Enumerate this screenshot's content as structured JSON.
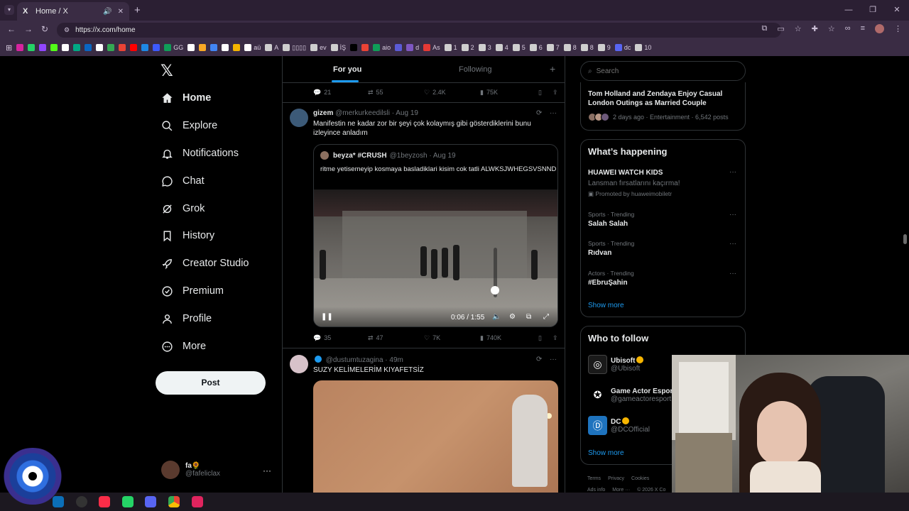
{
  "browser": {
    "tab_title": "Home / X",
    "url": "https://x.com/home",
    "new_tab_glyph": "+",
    "tab_close_glyph": "✕",
    "tab_audio_glyph": "🔊",
    "window_controls": [
      "—",
      "❐",
      "✕"
    ]
  },
  "bookmarks": [
    {
      "label": "",
      "color": "#d6249f"
    },
    {
      "label": "",
      "color": "#25d366"
    },
    {
      "label": "",
      "color": "#9146ff"
    },
    {
      "label": "",
      "color": "#53fc18"
    },
    {
      "label": "",
      "color": "#ffffff"
    },
    {
      "label": "",
      "color": "#00a884"
    },
    {
      "label": "",
      "color": "#0a66c2"
    },
    {
      "label": "",
      "color": "#ffffff"
    },
    {
      "label": "",
      "color": "#34a853"
    },
    {
      "label": "",
      "color": "#ea4335"
    },
    {
      "label": "",
      "color": "#ff0000"
    },
    {
      "label": "",
      "color": "#1e88e5"
    },
    {
      "label": "",
      "color": "#3d5afe"
    },
    {
      "label": "GG",
      "color": "#0f9d58"
    },
    {
      "label": "",
      "color": "#ffffff"
    },
    {
      "label": "",
      "color": "#f9a825"
    },
    {
      "label": "",
      "color": "#4285f4"
    },
    {
      "label": "",
      "color": "#ffffff"
    },
    {
      "label": "",
      "color": "#f4b400"
    },
    {
      "label": "aü",
      "color": "#ffffff"
    },
    {
      "label": "A",
      "color": "#cfcfcf"
    },
    {
      "label": "▯▯▯▯",
      "color": "#cfcfcf"
    },
    {
      "label": "ev",
      "color": "#cfcfcf"
    },
    {
      "label": "İŞ",
      "color": "#cfcfcf"
    },
    {
      "label": "",
      "color": "#000000"
    },
    {
      "label": "",
      "color": "#ea4335"
    },
    {
      "label": "aio",
      "color": "#0f9d58"
    },
    {
      "label": "",
      "color": "#5b5bd6"
    },
    {
      "label": "d",
      "color": "#7e57c2"
    },
    {
      "label": "As",
      "color": "#e53935"
    },
    {
      "label": "1",
      "color": "#cfcfcf"
    },
    {
      "label": "2",
      "color": "#cfcfcf"
    },
    {
      "label": "3",
      "color": "#cfcfcf"
    },
    {
      "label": "4",
      "color": "#cfcfcf"
    },
    {
      "label": "5",
      "color": "#cfcfcf"
    },
    {
      "label": "6",
      "color": "#cfcfcf"
    },
    {
      "label": "7",
      "color": "#cfcfcf"
    },
    {
      "label": "8",
      "color": "#cfcfcf"
    },
    {
      "label": "8",
      "color": "#cfcfcf"
    },
    {
      "label": "9",
      "color": "#cfcfcf"
    },
    {
      "label": "dc",
      "color": "#5865f2"
    },
    {
      "label": "10",
      "color": "#cfcfcf"
    }
  ],
  "sidebar": {
    "logo": "𝕏",
    "items": [
      {
        "label": "Home",
        "icon": "home-icon"
      },
      {
        "label": "Explore",
        "icon": "search-icon"
      },
      {
        "label": "Notifications",
        "icon": "bell-icon"
      },
      {
        "label": "Chat",
        "icon": "chat-icon"
      },
      {
        "label": "Grok",
        "icon": "grok-icon"
      },
      {
        "label": "History",
        "icon": "bookmark-icon"
      },
      {
        "label": "Creator Studio",
        "icon": "rocket-icon"
      },
      {
        "label": "Premium",
        "icon": "verified-icon"
      },
      {
        "label": "Profile",
        "icon": "person-icon"
      },
      {
        "label": "More",
        "icon": "more-circle-icon"
      }
    ],
    "post_label": "Post",
    "account": {
      "name": "fa🌻",
      "handle": "@fafeliclax",
      "more": "···"
    }
  },
  "feed": {
    "tabs": [
      "For you",
      "Following"
    ],
    "add_glyph": "+",
    "top_actions": {
      "replies": "21",
      "reposts": "55",
      "likes": "2.4K",
      "views": "75K"
    },
    "tweet1": {
      "name": "gizem",
      "meta": "@merkurkeedilsli · Aug 19",
      "text": "Manifestin ne kadar zor bir şeyi çok kolaymış gibi gösterdiklerini bunu izleyince anladım",
      "quote": {
        "name": "beyza* #CRUSH",
        "meta": "@1beyzosh · Aug 19",
        "text": "ritme yetisemeyip kosmaya basladiklari kisim cok tatli ALWKSJWHEGSVSNND"
      },
      "video": {
        "time": "0:06 / 1:55",
        "volume": 0.15
      },
      "actions": {
        "replies": "35",
        "reposts": "47",
        "likes": "7K",
        "views": "740K"
      }
    },
    "tweet2": {
      "meta": "@dustumtuzagina · 49m",
      "text": "SUZY KELİMELERİM KIYAFETSİZ"
    }
  },
  "search": {
    "placeholder": "Search"
  },
  "news": {
    "title": "Tom Holland and Zendaya Enjoy Casual London Outings as Married Couple",
    "meta": "2 days ago · Entertainment · 6,542 posts"
  },
  "happening": {
    "heading": "What’s happening",
    "promo": {
      "name": "HUAWEI WATCH KIDS",
      "sub": "Lansman fırsatlarını kaçırma!",
      "promoted": "Promoted by huaweimobiletr"
    },
    "trends": [
      {
        "cat": "Sports · Trending",
        "name": "Salah Salah"
      },
      {
        "cat": "Sports · Trending",
        "name": "Rıdvan"
      },
      {
        "cat": "Actors · Trending",
        "name": "#EbruŞahin"
      }
    ],
    "show_more": "Show more"
  },
  "who_to_follow": {
    "heading": "Who to follow",
    "accounts": [
      {
        "name": "Ubisoft",
        "handle": "@Ubisoft",
        "color": "#1a1a1a",
        "badge": "#f7b500"
      },
      {
        "name": "Game Actor Espor",
        "handle": "@gameactoresport",
        "color": "#000000",
        "badge": ""
      },
      {
        "name": "DC",
        "handle": "@DCOfficial",
        "color": "#1e73be",
        "badge": "#f7b500"
      }
    ],
    "show_more": "Show more"
  },
  "footer": {
    "row1": [
      "Terms",
      "Privacy",
      "Cookies"
    ],
    "row2": [
      "Ads info",
      "More ···",
      "© 2026 X Co"
    ]
  },
  "colors": {
    "accent": "#1d9bf0",
    "background": "#000000",
    "border": "#2f3336",
    "muted": "#71767b"
  }
}
